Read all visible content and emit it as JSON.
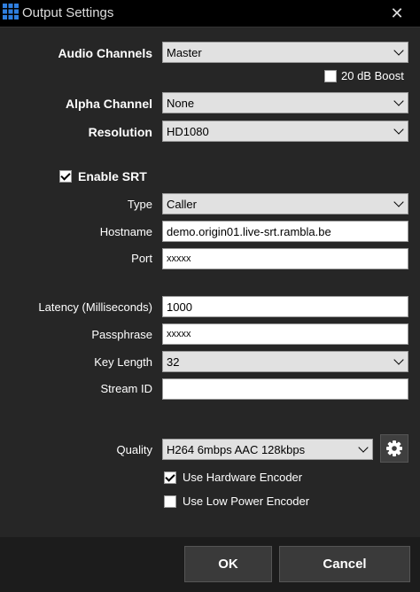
{
  "window": {
    "title": "Output Settings",
    "close_glyph": "✕",
    "icon": "app-grid-icon"
  },
  "audio_channels": {
    "label": "Audio Channels",
    "value": "Master"
  },
  "boost": {
    "label": "20 dB Boost",
    "checked": false
  },
  "alpha_channel": {
    "label": "Alpha Channel",
    "value": "None"
  },
  "resolution": {
    "label": "Resolution",
    "value": "HD1080"
  },
  "srt": {
    "label": "Enable SRT",
    "checked": true
  },
  "type": {
    "label": "Type",
    "value": "Caller"
  },
  "hostname": {
    "label": "Hostname",
    "value": "demo.origin01.live-srt.rambla.be"
  },
  "port": {
    "label": "Port",
    "value": "xxxxx"
  },
  "latency": {
    "label": "Latency (Milliseconds)",
    "value": "1000"
  },
  "passphrase": {
    "label": "Passphrase",
    "value": "xxxxx"
  },
  "key_length": {
    "label": "Key Length",
    "value": "32"
  },
  "stream_id": {
    "label": "Stream ID",
    "value": ""
  },
  "quality": {
    "label": "Quality",
    "value": "H264 6mbps AAC 128kbps",
    "settings_icon": "gear-icon"
  },
  "hardware_encoder": {
    "label": "Use Hardware Encoder",
    "checked": true
  },
  "low_power_encoder": {
    "label": "Use Low Power Encoder",
    "checked": false
  },
  "buttons": {
    "ok": "OK",
    "cancel": "Cancel"
  },
  "colors": {
    "panel": "#262626",
    "footer": "#1c1c1c",
    "title_bar": "#000000",
    "field": "#ffffff",
    "select": "#e1e1e1"
  }
}
